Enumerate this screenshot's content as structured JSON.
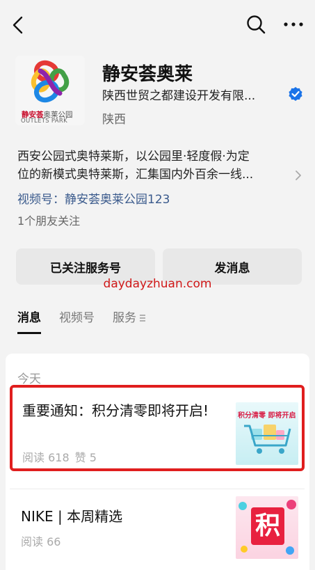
{
  "header": {
    "back_icon": "chevron-left-icon",
    "search_icon": "search-icon",
    "more_icon": "ellipsis-icon"
  },
  "account": {
    "name": "静安荟奥莱",
    "company": "陕西世贸之都建设开发有限...",
    "verified_icon": "verified-badge-icon",
    "verified_color": "#1a73e8",
    "region": "陕西",
    "logo": {
      "cn_red": "静安荟",
      "cn_gray": "奥莱公园",
      "en": "OUTLETS PARK"
    },
    "description_line1": "西安公园式奥特莱斯，以公园里·轻度假·为定",
    "description_line2": "位的新模式奥特莱斯，汇集国内外百余一线...",
    "channel": "视频号：静安荟奥莱公园123",
    "friends": "1个朋友关注"
  },
  "actions": {
    "follow_label": "已关注服务号",
    "message_label": "发消息"
  },
  "watermark": "daydayzhuan.com",
  "tabs": [
    {
      "label": "消息",
      "active": true
    },
    {
      "label": "视频号",
      "active": false
    },
    {
      "label": "服务",
      "active": false
    }
  ],
  "feed": {
    "section_label": "今天",
    "items": [
      {
        "title": "重要通知：积分清零即将开启!",
        "read_label": "阅读 618",
        "like_label": "赞 5",
        "thumb_text": "积分清零  即将开启",
        "highlighted": true
      },
      {
        "title": "NIKE | 本周精选",
        "read_label": "阅读 66",
        "thumb_text": "积",
        "highlighted": false
      }
    ]
  },
  "colors": {
    "link": "#3a5a8c",
    "highlight_border": "#e01e1e",
    "watermark": "#d01818",
    "brand_red": "#c8102e"
  }
}
